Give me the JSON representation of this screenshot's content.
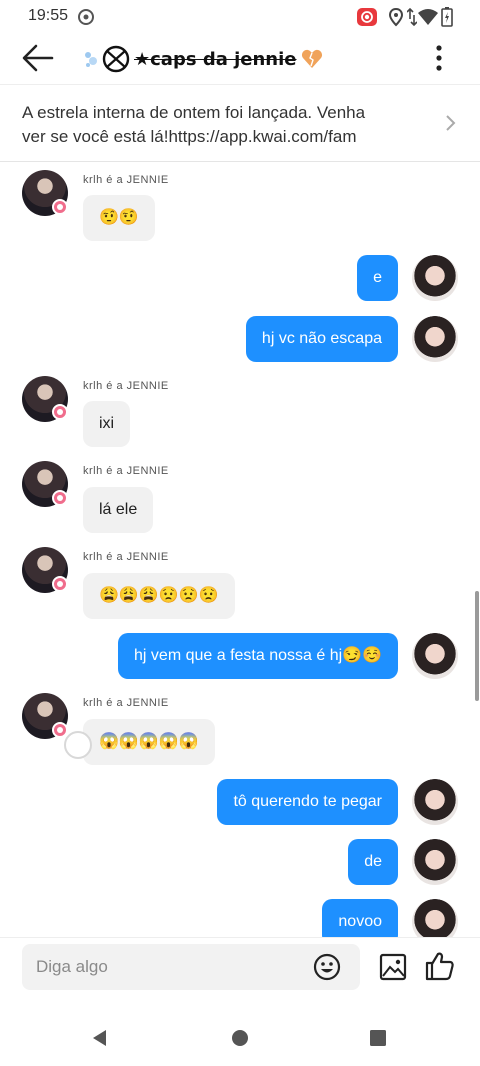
{
  "status_bar": {
    "time": "19:55",
    "icons": [
      "settings-notification-icon",
      "screen-record-icon",
      "location-icon",
      "data-transfer-icon",
      "wifi-icon",
      "battery-charging-icon"
    ],
    "record_color": "#e8383d"
  },
  "header": {
    "title": "★caps da jennie",
    "icons": [
      "back-arrow-icon",
      "bubbles-icon",
      "broken-heart-icon",
      "overflow-menu-icon"
    ]
  },
  "banner": {
    "text_line1": "A estrela interna de ontem foi lançada. Venha",
    "text_line2": "ver se você está lá!https://app.kwai.com/fam"
  },
  "messages": [
    {
      "side": "in",
      "sender": "krlh é a JENNIE",
      "text": "🤨🤨"
    },
    {
      "side": "out",
      "text": "e"
    },
    {
      "side": "out",
      "text": "hj vc não escapa"
    },
    {
      "side": "in",
      "sender": "krlh é a JENNIE",
      "text": "ixi"
    },
    {
      "side": "in",
      "sender": "krlh é a JENNIE",
      "text": "lá ele"
    },
    {
      "side": "in",
      "sender": "krlh é a JENNIE",
      "text": "😩😩😩😟😟😟"
    },
    {
      "side": "out",
      "text": "hj vem que a festa nossa é hj😏☺️"
    },
    {
      "side": "in",
      "sender": "krlh é a JENNIE",
      "text": "😱😱😱😱😱"
    },
    {
      "side": "out",
      "text": "tô querendo te pegar"
    },
    {
      "side": "out",
      "text": "de"
    },
    {
      "side": "out",
      "text": "novoo"
    }
  ],
  "input": {
    "placeholder": "Diga algo",
    "icons": [
      "emoji-icon",
      "image-icon",
      "like-icon"
    ]
  },
  "colors": {
    "outgoing_bubble": "#1e90ff",
    "incoming_bubble": "#f1f1f1",
    "badge": "#f06d8c"
  },
  "nav_bar": {
    "icons": [
      "nav-back-icon",
      "nav-home-icon",
      "nav-recents-icon"
    ]
  }
}
